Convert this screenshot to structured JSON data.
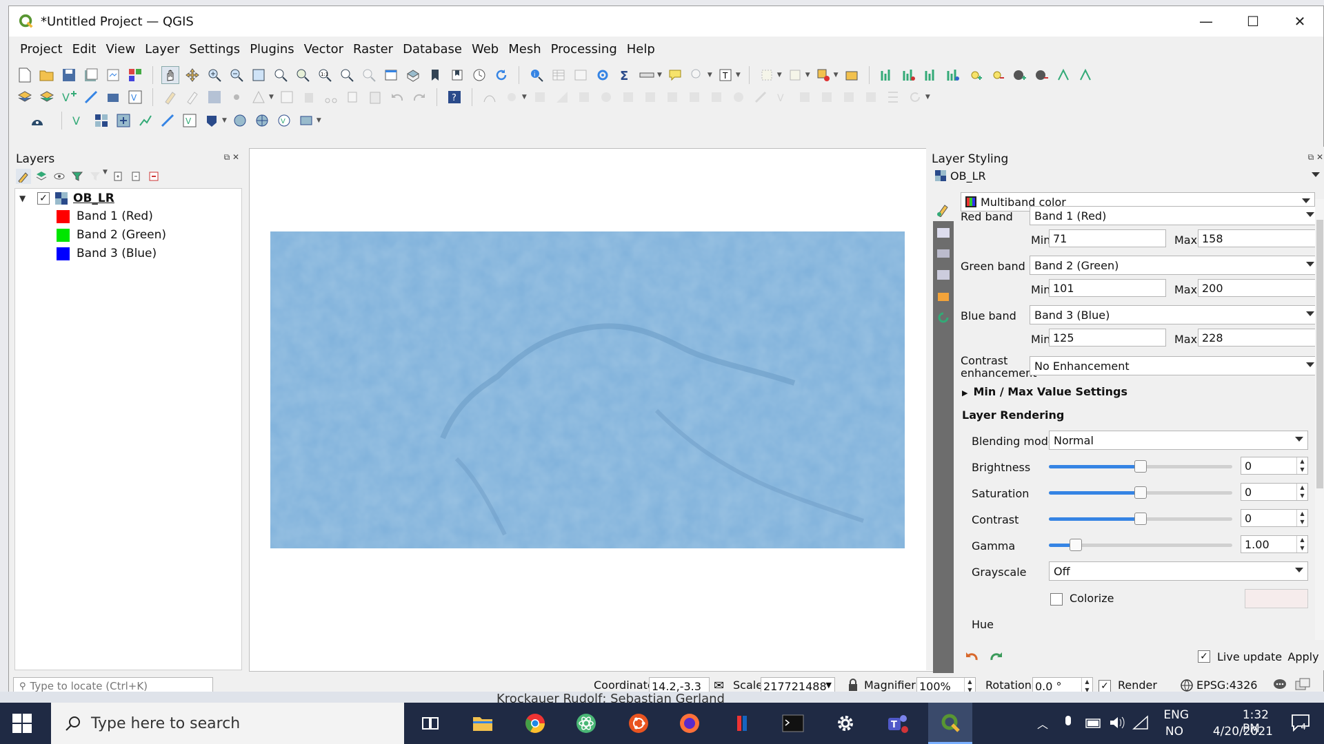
{
  "window": {
    "title": "*Untitled Project — QGIS",
    "controls": {
      "minimize": "—",
      "maximize": "☐",
      "close": "✕"
    }
  },
  "menu": [
    "Project",
    "Edit",
    "View",
    "Layer",
    "Settings",
    "Plugins",
    "Vector",
    "Raster",
    "Database",
    "Web",
    "Mesh",
    "Processing",
    "Help"
  ],
  "layers_panel": {
    "title": "Layers",
    "layer_name": "OB_LR",
    "bands": [
      {
        "label": "Band 1 (Red)",
        "color": "#ff0000"
      },
      {
        "label": "Band 2 (Green)",
        "color": "#00e600"
      },
      {
        "label": "Band 3 (Blue)",
        "color": "#0000ff"
      }
    ]
  },
  "map": {
    "raster_color": "#7fb1db"
  },
  "styling_panel": {
    "title": "Layer Styling",
    "layer_select": "OB_LR",
    "renderer": "Multiband color",
    "red_band_label": "Red band",
    "red_band": "Band 1 (Red)",
    "red_min": "71",
    "red_max": "158",
    "green_band_label": "Green band",
    "green_band": "Band 2 (Green)",
    "green_min": "101",
    "green_max": "200",
    "blue_band_label": "Blue band",
    "blue_band": "Band 3 (Blue)",
    "blue_min": "125",
    "blue_max": "228",
    "min_label": "Min",
    "max_label": "Max",
    "contrast_label_1": "Contrast",
    "contrast_label_2": "enhancement",
    "contrast_value": "No Enhancement",
    "minmax_settings": "Min / Max Value Settings",
    "layer_rendering": "Layer Rendering",
    "blending_label": "Blending mode",
    "blending_value": "Normal",
    "brightness_label": "Brightness",
    "brightness_value": "0",
    "brightness_level": 0.5,
    "saturation_label": "Saturation",
    "saturation_value": "0",
    "saturation_level": 0.5,
    "contrast_label": "Contrast",
    "contrast_num": "0",
    "contrast_level": 0.5,
    "gamma_label": "Gamma",
    "gamma_value": "1.00",
    "gamma_level": 0.12,
    "grayscale_label": "Grayscale",
    "grayscale_value": "Off",
    "colorize_label": "Colorize",
    "hue_label": "Hue",
    "live_update_label": "Live update",
    "apply_label": "Apply"
  },
  "statusbar": {
    "locator_placeholder": "Type to locate (Ctrl+K)",
    "coordinate_label": "Coordinate",
    "coordinate_value": "14.2,-3.3",
    "scale_label": "Scale",
    "scale_value": "217721488",
    "magnifier_label": "Magnifier",
    "magnifier_value": "100%",
    "rotation_label": "Rotation",
    "rotation_value": "0.0 °",
    "render_label": "Render",
    "crs": "EPSG:4326"
  },
  "taskbar": {
    "search_placeholder": "Type here to search",
    "peek_text": "Krockauer Rudolf; Sebastian Gerland",
    "lang_1": "ENG",
    "lang_2": "NO",
    "time": "1:32 PM",
    "date": "4/20/2021",
    "notifications": "4"
  },
  "colors": {
    "accent": "#3584e4",
    "taskbar_bg": "#1f2a44",
    "qgis_green": "#589632"
  }
}
